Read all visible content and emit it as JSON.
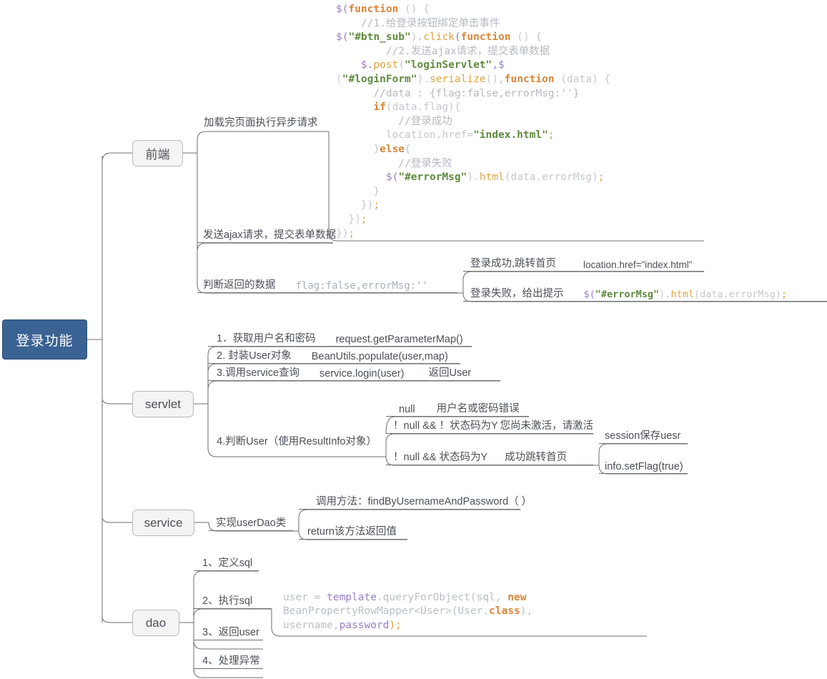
{
  "diagram": {
    "title": "登录功能",
    "root": {
      "label": "登录功能"
    },
    "branches": [
      {
        "label": "前端"
      },
      {
        "label": "servlet"
      },
      {
        "label": "service"
      },
      {
        "label": "dao"
      }
    ]
  },
  "frontend": {
    "node_async": "加载完页面执行异步请求",
    "node_ajax": "发送ajax请求，提交表单数据",
    "node_judge": "判断返回的数据",
    "node_judge_value": "flag:false,errorMsg:''",
    "result_success": "登录成功,跳转首页",
    "result_success_code": "location.href=\"index.html\"",
    "result_fail": "登录失败，给出提示",
    "result_fail_code_1": "$(",
    "result_fail_code_2": "\"#errorMsg\"",
    "result_fail_code_3": ").",
    "result_fail_code_4": "html",
    "result_fail_code_5": "(data.errorMsg)",
    "result_fail_code_6": ";",
    "code": {
      "l1_a": "$(",
      "l1_b": "function",
      "l1_c": " () {",
      "l2": "    //1.给登录按钮绑定单击事件",
      "l3_a": "$(",
      "l3_b": "\"#btn_sub\"",
      "l3_c": ").",
      "l3_d": "click",
      "l3_e": "(",
      "l3_f": "function",
      "l3_g": " () {",
      "l4": "        //2.发送ajax请求，提交表单数据",
      "l5_a": "    $.",
      "l5_b": "post",
      "l5_c": "(",
      "l5_d": "\"loginServlet\"",
      "l5_e": ",$",
      "l6_a": "(",
      "l6_b": "\"#loginForm\"",
      "l6_c": ").",
      "l6_d": "serialize",
      "l6_e": "(),",
      "l6_f": "function",
      "l6_g": " (data) {",
      "l7": "      //data : {flag:false,errorMsg:''}",
      "l8_a": "      ",
      "l8_b": "if",
      "l8_c": "(data.flag){",
      "l9": "          //登录成功",
      "l10_a": "        location.href=",
      "l10_b": "\"index.html\"",
      "l10_c": ";",
      "l11_a": "      }",
      "l11_b": "else",
      "l11_c": "{",
      "l12": "          //登录失败",
      "l13_a": "        $(",
      "l13_b": "\"#errorMsg\"",
      "l13_c": ").",
      "l13_d": "html",
      "l13_e": "(data.errorMsg)",
      "l13_f": ";",
      "l14": "      }",
      "l15_a": "    })",
      "l15_b": ";",
      "l16_a": "  })",
      "l16_b": ";",
      "l17_a": "})",
      "l17_b": ";"
    }
  },
  "servlet": {
    "steps": [
      {
        "label": "1．获取用户名和密码",
        "value": "request.getParameterMap()"
      },
      {
        "label": "2. 封装User对象",
        "value": "BeanUtils.populate(user,map)"
      },
      {
        "label": "3.调用service查询",
        "value": "service.login(user)",
        "extra": "返回User"
      },
      {
        "label": "4.判断User（使用ResultInfo对象）",
        "value": "",
        "extra": ""
      }
    ],
    "judge": {
      "case_null": "null",
      "case_null_result": "用户名或密码错误",
      "case_notnull_inactive": "！null &&  ！状态码为Y",
      "case_notnull_inactive_result": "您尚未激活，请激活",
      "case_notnull_active": "！null && 状态码为Y",
      "case_notnull_active_result": "成功跳转首页",
      "sub_session": "session保存uesr",
      "sub_flag": "info.setFlag(true)"
    }
  },
  "service": {
    "impl": "实现userDao类",
    "call_method": "调用方法：findByUsernameAndPassword（ ）",
    "return_value": "return该方法返回值"
  },
  "dao": {
    "steps": [
      "1、定义sql",
      "2、执行sql",
      "3、返回user",
      "4、处理异常"
    ],
    "code": {
      "l1_a": "user = ",
      "l1_b": "template",
      "l1_c": ".queryForObject(sql, ",
      "l1_d": "new",
      "l2_a": "BeanPropertyRowMapper<User>(User.",
      "l2_b": "class",
      "l2_c": "),",
      "l3_a": "username,",
      "l3_b": "password",
      "l3_c": ");"
    }
  },
  "colors": {
    "root_fill": "#3a6293",
    "root_text": "#ffffff",
    "node_fill": "#f4f4f4",
    "node_border": "#b9b9b9",
    "line": "#6e6e6e",
    "text": "#4a5058",
    "code_dim": "#b9c0ca",
    "code_keyword": "#d9863a",
    "code_string": "#5f8a3f",
    "code_dollar": "#9b7ec4",
    "code_fn": "#e0a340"
  }
}
